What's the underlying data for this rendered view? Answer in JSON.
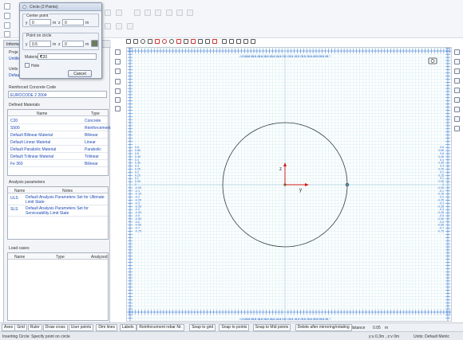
{
  "dialog": {
    "title": "Circle (2 Points)",
    "center_point_label": "Center point",
    "center_y_label": "y",
    "center_y_value": "0",
    "center_y_unit": "m",
    "center_z_label": "z",
    "center_z_value": "0",
    "center_z_unit": "m",
    "on_circle_label": "Point on circle",
    "on_circle_y_label": "y",
    "on_circle_y_value": "0.5",
    "on_circle_y_unit": "m",
    "on_circle_z_label": "z",
    "on_circle_z_value": "0",
    "on_circle_z_unit": "m",
    "material_label": "Material",
    "material_value": "C20",
    "hole_label": "Hole",
    "cancel_label": "Cancel"
  },
  "left_panel": {
    "tab_label": "Informat",
    "project_label": "Proje",
    "project_value": "Untitle",
    "units_label": "Units",
    "units_value": "Defaul",
    "code_label": "Reinforced Concrete Code",
    "code_value": "EUROCODE 2 2004",
    "materials_title": "Defined Materials",
    "materials_headers": [
      "Name",
      "Type"
    ],
    "materials": [
      [
        "C20",
        "Concrete"
      ],
      [
        "S500",
        "Reinforcement"
      ],
      [
        "Default Bilinear Material",
        "Bilinear"
      ],
      [
        "Default Linear Material",
        "Linear"
      ],
      [
        "Default Parabolic Material",
        "Parabolic"
      ],
      [
        "Default Trilinear Material",
        "Trilinear"
      ],
      [
        "Fe 360",
        "Bilinear"
      ]
    ],
    "analysis_title": "Analysis parameters",
    "analysis_headers": [
      "Name",
      "Notes"
    ],
    "analysis": [
      [
        "ULS",
        "Default Analysis Parameters Set for Ultimate Limit State"
      ],
      [
        "SLS",
        "Default Analysis Parameters Set for Serviceability Limit State"
      ]
    ],
    "loads_title": "Load cases",
    "loads_headers": [
      "Name",
      "Type",
      "Analyzed"
    ]
  },
  "canvas": {
    "x_ticks": [
      "-0.7",
      "-0.65",
      "-0.6",
      "-0.55",
      "-0.5",
      "-0.45",
      "-0.4",
      "-0.35",
      "-0.3",
      "-0.25",
      "-0.2",
      "-0.15",
      "-0.1",
      "-0.05",
      "0",
      "0.05",
      "0.1",
      "0.15",
      "0.2",
      "0.25",
      "0.3",
      "0.35",
      "0.4",
      "0.45",
      "0.5",
      "0.55",
      "0.6",
      "0.65",
      "0.7"
    ],
    "y_ticks": [
      "0.6",
      "0.55",
      "0.5",
      "0.45",
      "0.4",
      "0.35",
      "0.3",
      "0.25",
      "0.2",
      "0.15",
      "0.1",
      "0.05",
      "0",
      "-0.05",
      "-0.1",
      "-0.15",
      "-0.2",
      "-0.25",
      "-0.3",
      "-0.35",
      "-0.4",
      "-0.45",
      "-0.5",
      "-0.55",
      "-0.6",
      "-0.65",
      "-0.7",
      "-0.75"
    ],
    "axis_y_label": "y",
    "axis_z_label": "z",
    "circle_center": [
      0,
      0
    ],
    "circle_radius": 0.5
  },
  "bottom_bar": {
    "buttons": [
      "Axes",
      "Grid",
      "Ruler",
      "Draw cross",
      "User points",
      "Dim lines",
      "Labels",
      "Reinforcement rebar Nr.",
      "Snap to grid",
      "Snap to points",
      "Snap to Mid points",
      "Delete after mirroring/rotating"
    ],
    "grid_distance_label": "Grid distance",
    "grid_distance_value": "0.05",
    "grid_distance_unit": "m"
  },
  "status_bar": {
    "message": "Inserting Circle: Specify point on circle",
    "coords": "y:u 0,3m , z:v 0m",
    "units": "Units: Default Metric"
  }
}
